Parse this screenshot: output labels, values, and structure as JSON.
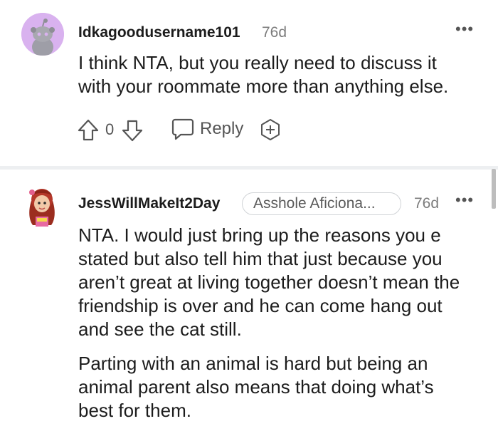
{
  "comments": [
    {
      "username": "Idkagoodusername101",
      "time": "76d",
      "more": "•••",
      "body": "I think NTA, but you really need to discuss it\nwith your roommate more than anything else.",
      "score": "0",
      "reply_label": "Reply",
      "avatar_icon": "snoo-avatar-icon"
    },
    {
      "username": "JessWillMakeIt2Day",
      "flair": "Asshole Aficiona...",
      "time": "76d",
      "more": "•••",
      "paragraphs": [
        "NTA. I would just bring up the reasons you e\nstated but also tell him that just because you\naren’t great at living together doesn’t mean the\nfriendship is over and he can come hang out\nand see the cat still.",
        "Parting with an animal is hard but being an\nanimal parent also means that doing what’s\nbest for them."
      ],
      "avatar_icon": "custom-avatar-icon"
    }
  ],
  "colors": {
    "avatar_bg": "#d9b2ef",
    "divider": "#edeff1",
    "meta_text": "#7c7c7c"
  }
}
